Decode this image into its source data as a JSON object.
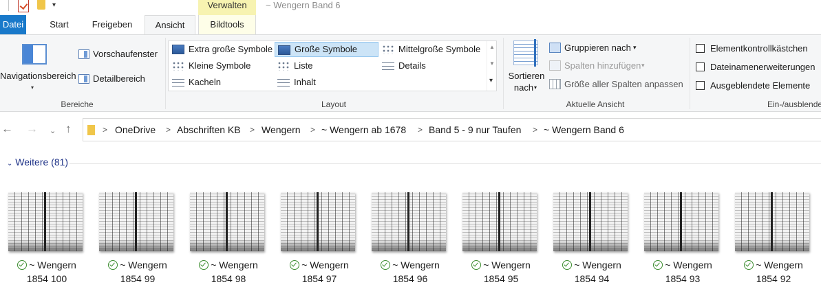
{
  "window": {
    "title": "~ Wengern Band 6",
    "context_tab_header": "Verwalten"
  },
  "ribbon_tabs": {
    "file": "Datei",
    "start": "Start",
    "share": "Freigeben",
    "view": "Ansicht",
    "picture_tools": "Bildtools"
  },
  "panes_group": {
    "navigation_pane": "Navigationsbereich",
    "preview_pane": "Vorschaufenster",
    "details_pane": "Detailbereich",
    "label": "Bereiche"
  },
  "layout_group": {
    "items": [
      "Extra große Symbole",
      "Große Symbole",
      "Mittelgroße Symbole",
      "Kleine Symbole",
      "Liste",
      "Details",
      "Kacheln",
      "Inhalt"
    ],
    "selected": "Große Symbole",
    "label": "Layout"
  },
  "current_view_group": {
    "sort_by_line1": "Sortieren",
    "sort_by_line2": "nach",
    "group_by": "Gruppieren nach",
    "add_columns": "Spalten hinzufügen",
    "size_all_columns": "Größe aller Spalten anpassen",
    "label": "Aktuelle Ansicht"
  },
  "show_hide_group": {
    "item_checkboxes": "Elementkontrollkästchen",
    "file_name_extensions": "Dateinamenerweiterungen",
    "hidden_items": "Ausgeblendete Elemente",
    "label": "Ein-/ausblenden"
  },
  "address_bar": {
    "breadcrumbs": [
      "OneDrive",
      "Abschriften KB",
      "Wengern",
      "~ Wengern ab 1678",
      "Band 5 - 9 nur Taufen",
      "~ Wengern Band 6"
    ]
  },
  "files": {
    "group_header": "Weitere (81)",
    "items": [
      {
        "line1": "~ Wengern",
        "line2": "1854 100"
      },
      {
        "line1": "~ Wengern",
        "line2": "1854 99"
      },
      {
        "line1": "~ Wengern",
        "line2": "1854 98"
      },
      {
        "line1": "~ Wengern",
        "line2": "1854 97"
      },
      {
        "line1": "~ Wengern",
        "line2": "1854 96"
      },
      {
        "line1": "~ Wengern",
        "line2": "1854 95"
      },
      {
        "line1": "~ Wengern",
        "line2": "1854 94"
      },
      {
        "line1": "~ Wengern",
        "line2": "1854 93"
      },
      {
        "line1": "~ Wengern",
        "line2": "1854 92"
      }
    ]
  },
  "colors": {
    "file_tab": "#1979ca",
    "context_tab": "#f7f3b1",
    "selection": "#cce4f7",
    "group_header_text": "#1e3287",
    "sync_status": "#3c8d2f"
  },
  "icons": {
    "sync_status": "check-circle-icon",
    "back": "arrow-left-icon",
    "forward": "arrow-right-icon",
    "recent": "chevron-down-icon",
    "up": "arrow-up-icon"
  }
}
